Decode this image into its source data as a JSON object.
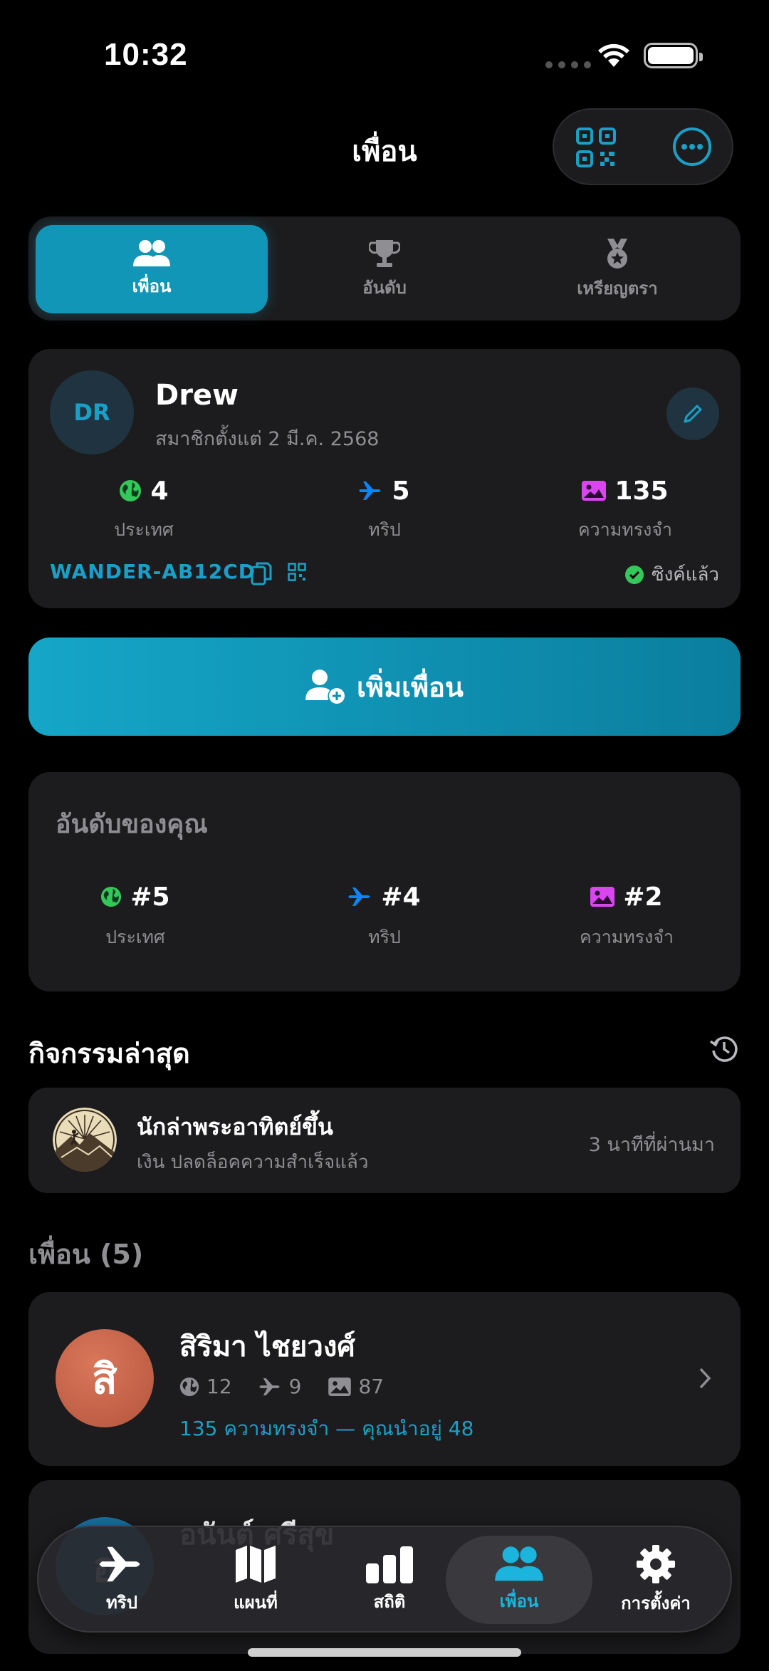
{
  "status_bar": {
    "time": "10:32"
  },
  "header": {
    "title": "เพื่อน"
  },
  "segments": [
    {
      "label": "เพื่อน",
      "icon": "people-icon",
      "active": true
    },
    {
      "label": "อันดับ",
      "icon": "trophy-icon",
      "active": false
    },
    {
      "label": "เหรียญตรา",
      "icon": "medal-icon",
      "active": false
    }
  ],
  "profile": {
    "initials": "DR",
    "name": "Drew",
    "member_since": "สมาชิกตั้งแต่ 2 มี.ค. 2568",
    "stats": [
      {
        "value": "4",
        "label": "ประเทศ",
        "icon": "globe-icon",
        "color": "#34c759"
      },
      {
        "value": "5",
        "label": "ทริป",
        "icon": "airplane-icon",
        "color": "#0a84ff"
      },
      {
        "value": "135",
        "label": "ความทรงจำ",
        "icon": "photo-icon",
        "color": "#d946ef"
      }
    ],
    "friend_code": "WANDER-AB12CD",
    "sync_status": "ซิงค์แล้ว"
  },
  "add_friend": {
    "label": "เพิ่มเพื่อน"
  },
  "ranking": {
    "title": "อันดับของคุณ",
    "items": [
      {
        "value": "#5",
        "label": "ประเทศ",
        "icon": "globe-icon"
      },
      {
        "value": "#4",
        "label": "ทริป",
        "icon": "airplane-icon"
      },
      {
        "value": "#2",
        "label": "ความทรงจำ",
        "icon": "photo-icon"
      }
    ]
  },
  "recent": {
    "title": "กิจกรรมล่าสุด",
    "activity": {
      "title": "นักล่าพระอาทิตย์ขึ้น",
      "subtitle": "เงิน ปลดล็อคความสำเร็จแล้ว",
      "time": "3 นาทีที่ผ่านมา"
    }
  },
  "friends": {
    "title": "เพื่อน (5)",
    "items": [
      {
        "initial": "สิ",
        "name": "สิริมา ไชยวงศ์",
        "countries": "12",
        "trips": "9",
        "memories": "87",
        "note": "135 ความทรงจำ — คุณนำอยู่ 48",
        "color": "#c4634a"
      },
      {
        "initial": "อ",
        "name": "อนันต์ ศรีสุข",
        "countries": "",
        "trips": "",
        "memories": "",
        "note": "",
        "color": "#1a6fa0"
      }
    ]
  },
  "tabbar": [
    {
      "label": "ทริป",
      "icon": "airplane-icon",
      "active": false
    },
    {
      "label": "แผนที่",
      "icon": "map-icon",
      "active": false
    },
    {
      "label": "สถิติ",
      "icon": "chart-icon",
      "active": false
    },
    {
      "label": "เพื่อน",
      "icon": "people-icon",
      "active": true
    },
    {
      "label": "การตั้งค่า",
      "icon": "gear-icon",
      "active": false
    }
  ],
  "colors": {
    "accent": "#1296b8",
    "background": "#000000",
    "card": "#1c1c1e"
  }
}
